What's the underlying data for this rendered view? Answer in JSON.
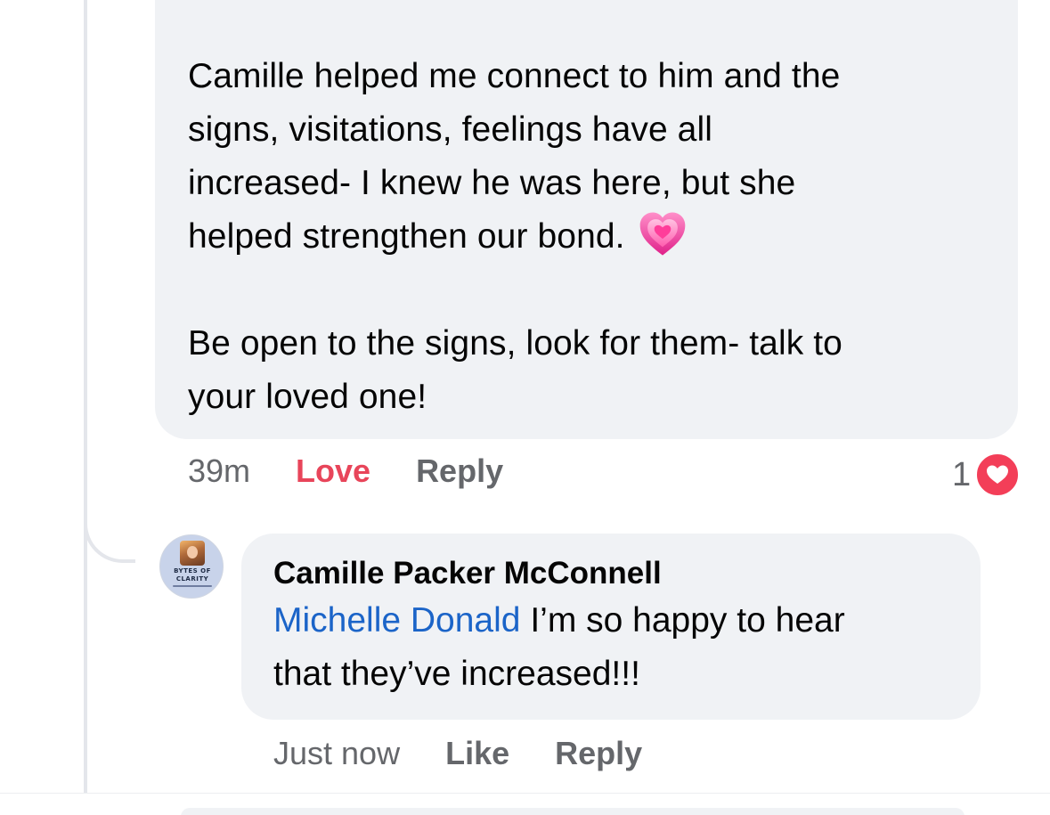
{
  "first_comment": {
    "text_lines": [
      "Camille helped me connect to him and the",
      "signs, visitations, feelings have all",
      "increased- I knew he was here, but she",
      "helped strengthen our bond."
    ],
    "paragraph_2": "Be open to the signs, look for them- talk to\nyour loved one!",
    "emoji": "growing-heart-emoji",
    "time": "39m",
    "love_label": "Love",
    "reply_label": "Reply",
    "reaction_count": "1",
    "reaction_type": "love-reaction-icon"
  },
  "reply_comment": {
    "avatar_text": "BYTES OF\nCLARITY",
    "author": "Camille Packer McConnell",
    "mention": "Michelle Donald",
    "text": " I’m so happy to hear\nthat they’ve increased!!!",
    "time": "Just now",
    "like_label": "Like",
    "reply_label": "Reply"
  },
  "colors": {
    "bubble": "#f0f2f5",
    "love": "#e8455a",
    "mention": "#1b64c8",
    "meta": "#65676b"
  }
}
